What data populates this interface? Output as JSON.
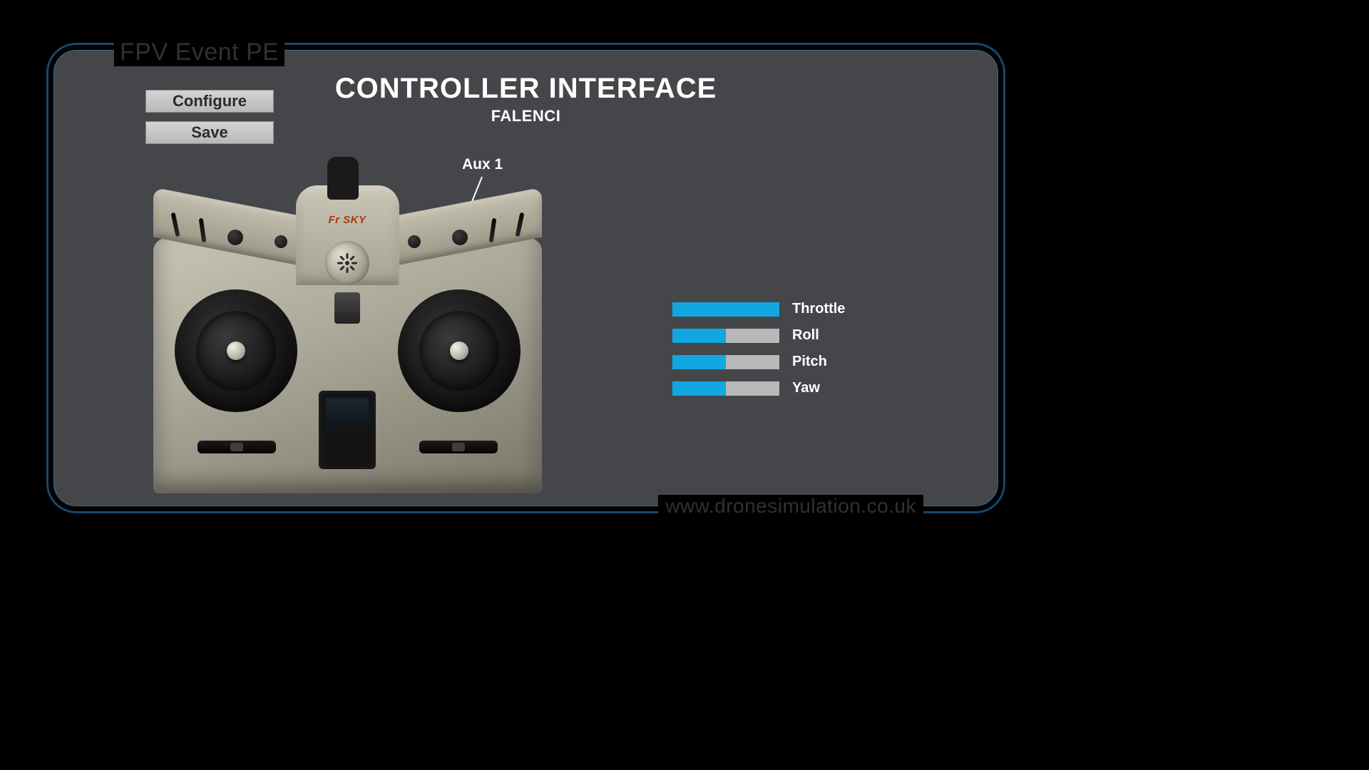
{
  "frame": {
    "legend_title": "FPV Event PE",
    "legend_url": "www.dronesimulation.co.uk"
  },
  "header": {
    "title": "CONTROLLER INTERFACE",
    "subtitle": "FALENCI"
  },
  "buttons": {
    "configure": "Configure",
    "save": "Save"
  },
  "annotation": {
    "aux1": "Aux 1"
  },
  "controller": {
    "brand": "Fr SKY"
  },
  "channels": [
    {
      "label": "Throttle",
      "value_percent": 100
    },
    {
      "label": "Roll",
      "value_percent": 50
    },
    {
      "label": "Pitch",
      "value_percent": 50
    },
    {
      "label": "Yaw",
      "value_percent": 50
    }
  ],
  "colors": {
    "accent": "#12a7e0",
    "panel_bg": "#444649",
    "border_outer": "#16486e",
    "border_inner": "#3a6e95"
  }
}
